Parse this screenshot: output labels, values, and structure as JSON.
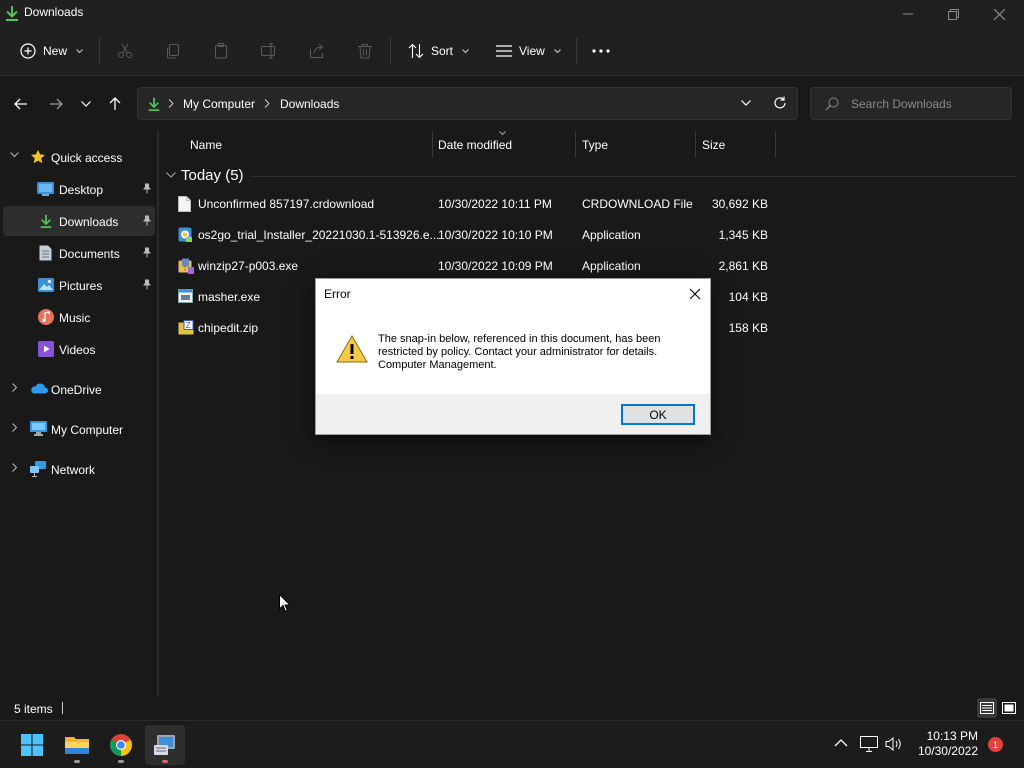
{
  "window": {
    "title": "Downloads"
  },
  "commandbar": {
    "new_label": "New",
    "sort_label": "Sort",
    "view_label": "View"
  },
  "address": {
    "crumbs": [
      "My Computer",
      "Downloads"
    ],
    "search_placeholder": "Search Downloads"
  },
  "sidebar": {
    "quick_access": "Quick access",
    "items": [
      {
        "label": "Desktop"
      },
      {
        "label": "Downloads"
      },
      {
        "label": "Documents"
      },
      {
        "label": "Pictures"
      },
      {
        "label": "Music"
      },
      {
        "label": "Videos"
      }
    ],
    "roots": [
      {
        "label": "OneDrive"
      },
      {
        "label": "My Computer"
      },
      {
        "label": "Network"
      }
    ]
  },
  "columns": {
    "name": "Name",
    "date": "Date modified",
    "type": "Type",
    "size": "Size"
  },
  "group": {
    "label": "Today (5)"
  },
  "files": [
    {
      "name": "Unconfirmed 857197.crdownload",
      "date": "10/30/2022 10:11 PM",
      "type": "CRDOWNLOAD File",
      "size": "30,692 KB"
    },
    {
      "name": "os2go_trial_Installer_20221030.1-513926.e...",
      "date": "10/30/2022 10:10 PM",
      "type": "Application",
      "size": "1,345 KB"
    },
    {
      "name": "winzip27-p003.exe",
      "date": "10/30/2022 10:09 PM",
      "type": "Application",
      "size": "2,861 KB"
    },
    {
      "name": "masher.exe",
      "date": "",
      "type": "",
      "size": "104 KB"
    },
    {
      "name": "chipedit.zip",
      "date": "",
      "type": "",
      "size": "158 KB"
    }
  ],
  "status": {
    "count": "5 items"
  },
  "dialog": {
    "title": "Error",
    "message": "The snap-in below, referenced in this document, has been restricted by policy. Contact your administrator for details. Computer Management.",
    "ok_label": "OK"
  },
  "taskbar": {
    "time": "10:13 PM",
    "date": "10/30/2022",
    "notification_count": "1"
  },
  "colors": {
    "accent": "#0078d7",
    "folder_green": "#4fc35c",
    "badge": "#e0443c"
  }
}
